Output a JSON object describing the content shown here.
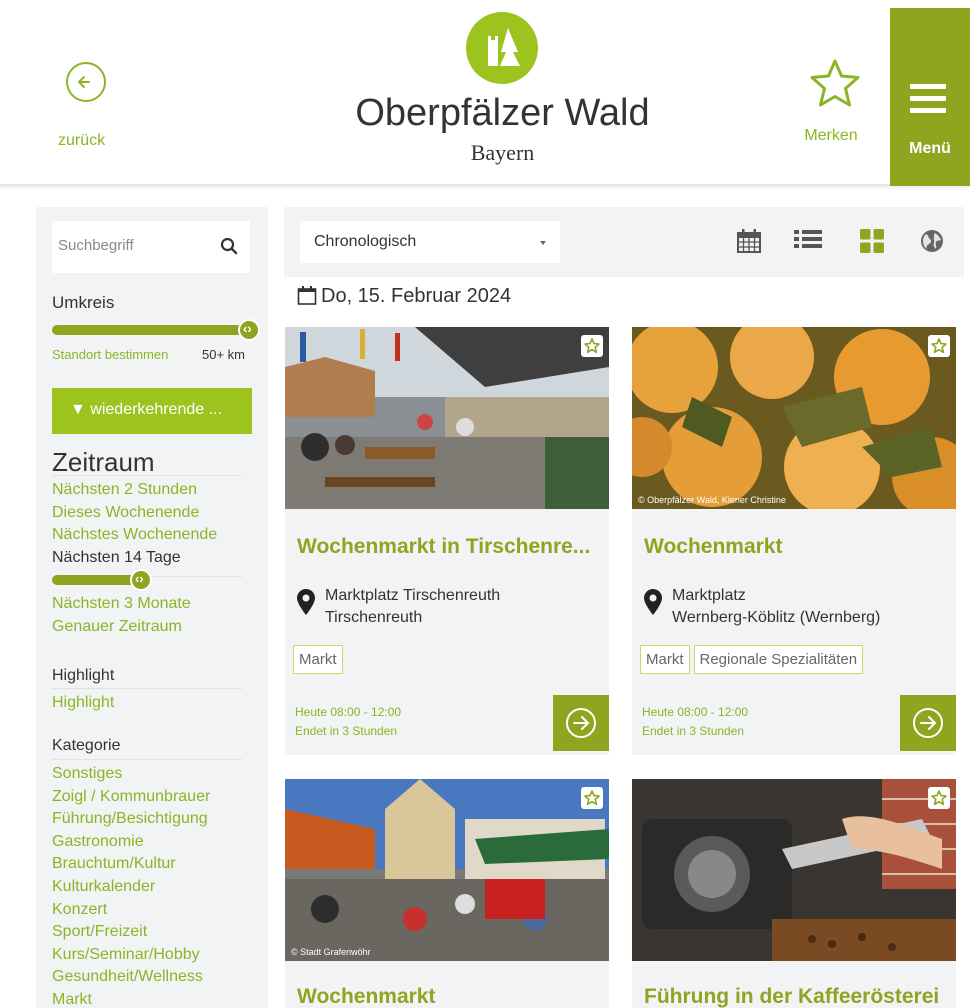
{
  "header": {
    "back_label": "zurück",
    "logo_title": "Oberpfälzer Wald",
    "logo_subtitle": "Bayern",
    "merken_label": "Merken",
    "menu_label": "Menü"
  },
  "sidebar": {
    "search_placeholder": "Suchbegriff",
    "umkreis_heading": "Umkreis",
    "umkreis_value": 1.0,
    "standort_link": "Standort bestimmen",
    "radius_label": "50+ km",
    "filter_button": "wiederkehrende ...",
    "zeitraum_heading": "Zeitraum",
    "zeitraum_items_top": [
      "Nächsten 2 Stunden",
      "Dieses Wochenende",
      "Nächstes Wochenende"
    ],
    "zeitraum_active": "Nächsten 14 Tage",
    "zeitraum_slider_value": 0.45,
    "zeitraum_items_bottom": [
      "Nächsten 3 Monate",
      "Genauer Zeitraum"
    ],
    "highlight_heading": "Highlight",
    "highlight_items": [
      "Highlight"
    ],
    "kategorie_heading": "Kategorie",
    "kategorie_items": [
      "Sonstiges",
      "Zoigl / Kommunbrauer",
      "Führung/Besichtigung",
      "Gastronomie",
      "Brauchtum/Kultur",
      "Kulturkalender",
      "Konzert",
      "Sport/Freizeit",
      "Kurs/Seminar/Hobby",
      "Gesundheit/Wellness",
      "Markt"
    ]
  },
  "toolbar": {
    "sort_value": "Chronologisch",
    "views": [
      "calendar-icon",
      "list-icon",
      "grid-icon",
      "globe-icon"
    ],
    "active_view": "grid-icon"
  },
  "date_heading": "Do, 15. Februar 2024",
  "cards": [
    {
      "title": "Wochenmarkt in Tirschenre...",
      "location_line1": "Marktplatz Tirschenreuth",
      "location_line2": "Tirschenreuth",
      "tags": [
        "Markt"
      ],
      "time": "Heute 08:00 - 12:00",
      "ends": "Endet in 3 Stunden",
      "credit": ""
    },
    {
      "title": "Wochenmarkt",
      "location_line1": "Marktplatz",
      "location_line2": "Wernberg-Köblitz (Wernberg)",
      "tags": [
        "Markt",
        "Regionale Spezialitäten"
      ],
      "time": "Heute 08:00 - 12:00",
      "ends": "Endet in 3 Stunden",
      "credit": "© Oberpfälzer Wald, Kiener Christine"
    },
    {
      "title": "Wochenmarkt",
      "location_line1": "",
      "location_line2": "",
      "tags": [],
      "time": "",
      "ends": "",
      "credit": "© Stadt Grafenwöhr"
    },
    {
      "title": "Führung in der Kaffeerösterei",
      "location_line1": "",
      "location_line2": "",
      "tags": [],
      "time": "",
      "ends": "",
      "credit": ""
    }
  ],
  "colors": {
    "accent": "#8ea520",
    "accent_light": "#9dc31e",
    "panel_bg": "#f1f3f5"
  }
}
